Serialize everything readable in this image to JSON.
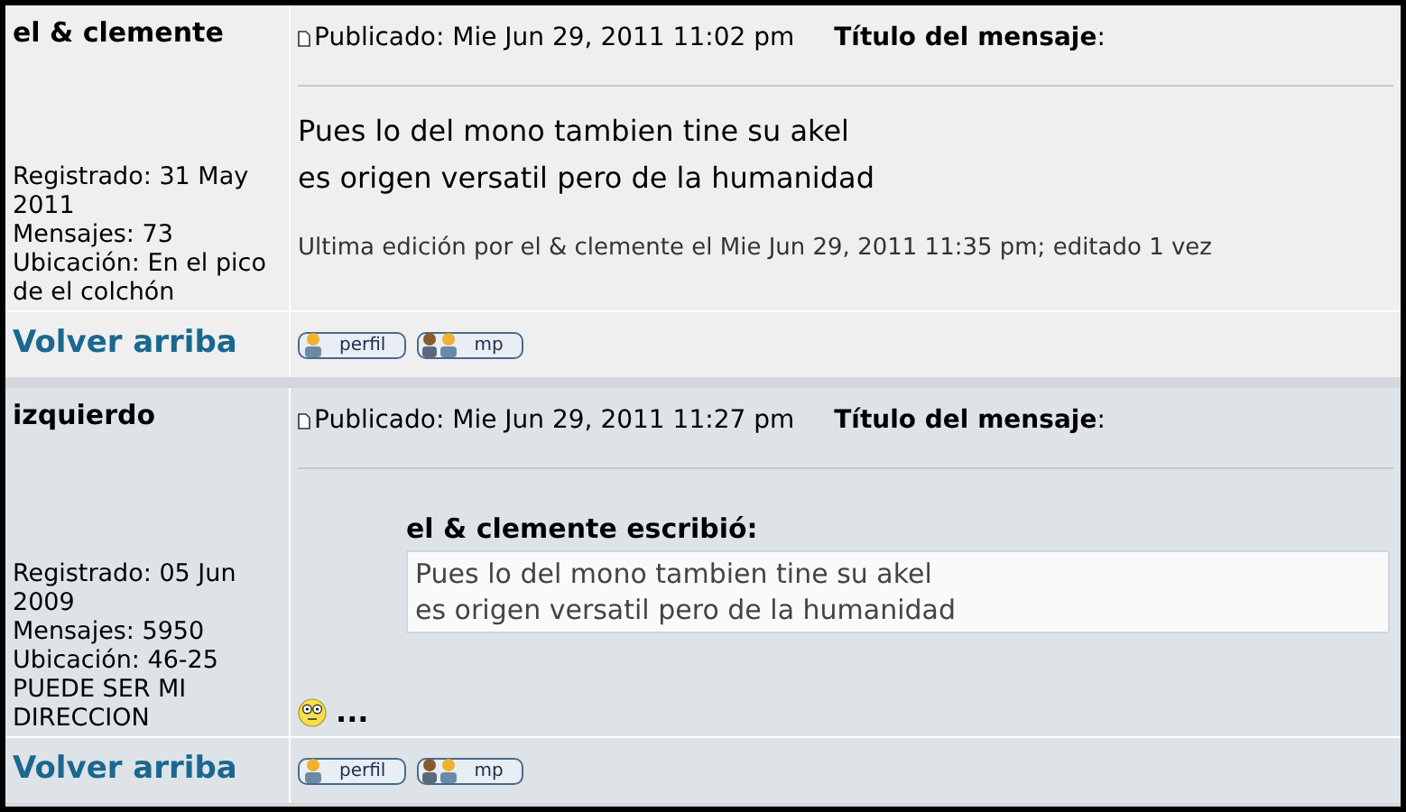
{
  "posts": [
    {
      "author": "el & clemente",
      "details": [
        "Registrado: 31 May 2011",
        "Mensajes: 73",
        "Ubicación: En el pico de el colchón"
      ],
      "posted": "Publicado: Mie Jun 29, 2011 11:02 pm",
      "title_label": "Título del mensaje",
      "title_colon": ":",
      "blocks": [
        {
          "kind": "text",
          "lines": [
            "Pues lo del mono tambien tine su akel",
            "es origen versatil pero de la humanidad"
          ]
        },
        {
          "kind": "edit_note",
          "text": "Ultima edición por el & clemente el Mie Jun 29, 2011 11:35 pm; editado 1 vez"
        }
      ],
      "back_to_top": "Volver arriba",
      "buttons": [
        {
          "kind": "profile",
          "label": "perfil"
        },
        {
          "kind": "pm",
          "label": "mp"
        }
      ]
    },
    {
      "author": "izquierdo",
      "details": [
        "Registrado: 05 Jun 2009",
        "Mensajes: 5950",
        "Ubicación: 46-25 PUEDE SER MI DIRECCION"
      ],
      "posted": "Publicado: Mie Jun 29, 2011 11:27 pm",
      "title_label": "Título del mensaje",
      "title_colon": ":",
      "blocks": [
        {
          "kind": "quote",
          "author": "el & clemente escribió:",
          "lines": [
            "Pues lo del mono tambien tine su akel",
            "es origen versatil pero de la humanidad"
          ]
        },
        {
          "kind": "smiley_text",
          "text": "..."
        }
      ],
      "back_to_top": "Volver arriba",
      "buttons": [
        {
          "kind": "profile",
          "label": "perfil"
        },
        {
          "kind": "pm",
          "label": "mp"
        }
      ]
    }
  ]
}
